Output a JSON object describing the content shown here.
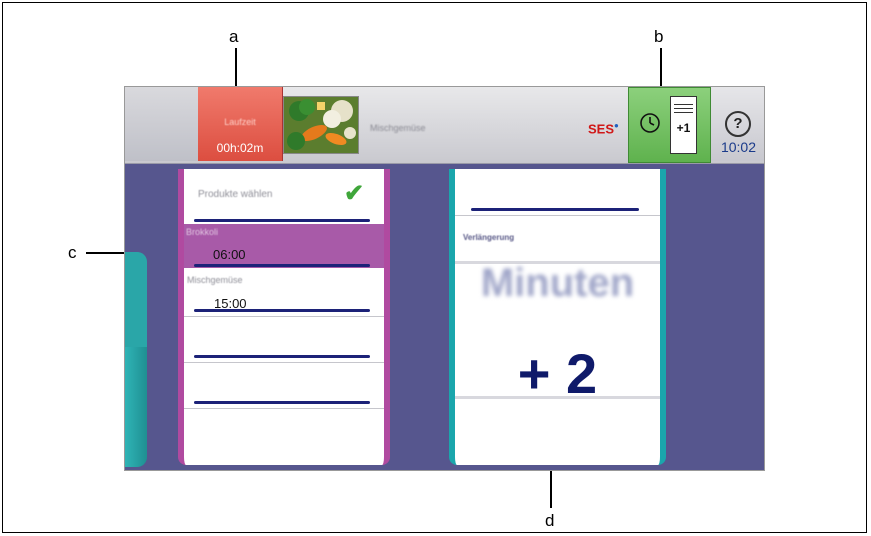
{
  "callouts": {
    "a": "a",
    "b": "b",
    "c": "c",
    "d": "d"
  },
  "topbar": {
    "timer_label": "Laufzeit",
    "timer_value": "00h:02m",
    "program_name": "Mischgemüse",
    "ses_label": "SES",
    "plus_one_label": "+1",
    "help_label": "?",
    "clock": "10:02"
  },
  "left_panel": {
    "title": "Produkte wählen",
    "items": [
      {
        "name": "Brokkoli",
        "time": "06:00",
        "selected": true
      },
      {
        "name": "Mischgemüse",
        "time": "15:00",
        "selected": false
      }
    ]
  },
  "right_panel": {
    "label": "Verlängerung",
    "unit": "Minuten",
    "value": "+ 2"
  },
  "colors": {
    "screen_bg": "#56568e",
    "timer_button": "#e05a4c",
    "green_button": "#6cbc5a",
    "left_accent": "#b04aa0",
    "right_accent": "#1aa6ac",
    "dark_line": "#1c2278"
  }
}
